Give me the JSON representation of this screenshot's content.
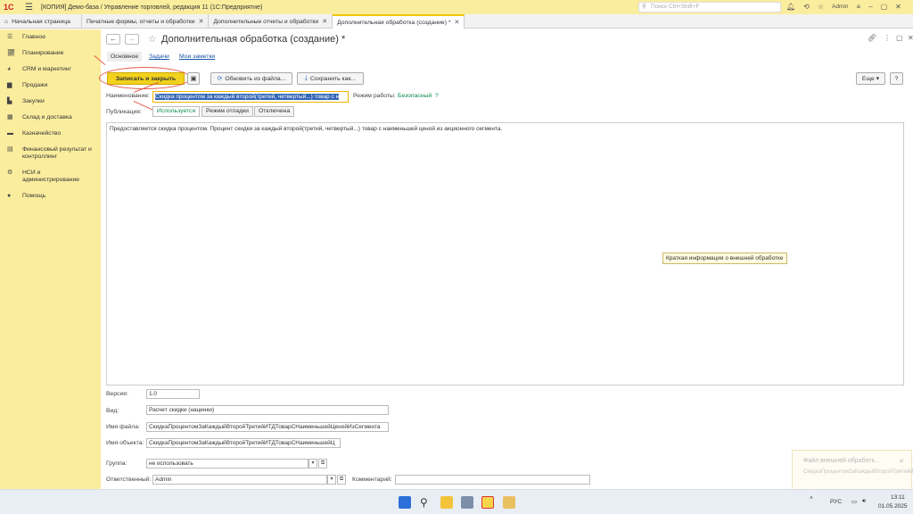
{
  "window": {
    "title": "[КОПИЯ] Демо-база / Управление торговлей, редакция 11  (1С:Предприятие)",
    "search_placeholder": "Поиск Ctrl+Shift+F",
    "user": "Admin"
  },
  "tabs": [
    {
      "label": "Начальная страница"
    },
    {
      "label": "Печатные формы, отчеты и обработки"
    },
    {
      "label": "Дополнительные отчеты и обработки"
    },
    {
      "label": "Дополнительная обработка (создание) *"
    }
  ],
  "sidebar": {
    "items": [
      {
        "label": "Главное",
        "icon": "menu-icon"
      },
      {
        "label": "Планирование",
        "icon": "chart-icon"
      },
      {
        "label": "CRM и маркетинг",
        "icon": "crm-icon"
      },
      {
        "label": "Продажи",
        "icon": "bag-icon"
      },
      {
        "label": "Закупки",
        "icon": "cart-icon"
      },
      {
        "label": "Склад и доставка",
        "icon": "warehouse-icon"
      },
      {
        "label": "Казначейство",
        "icon": "money-icon"
      },
      {
        "label": "Финансовый результат и контроллинг",
        "icon": "finance-icon"
      },
      {
        "label": "НСИ и администрирование",
        "icon": "gear-icon"
      },
      {
        "label": "Помощь",
        "icon": "help-icon"
      }
    ]
  },
  "form": {
    "title": "Дополнительная обработка (создание) *",
    "subtabs": {
      "main": "Основное",
      "tasks": "Задачи",
      "notes": "Мои заметки"
    },
    "buttons": {
      "save_close": "Записать и закрыть",
      "update_from_file": "Обновить из файла...",
      "save_as": "Сохранить как...",
      "more": "Еще",
      "help": "?"
    },
    "name_label": "Наименование:",
    "name_value": "Скидка процентом за каждый второй(третий, четвертый...) товар с н",
    "mode_label": "Режим работы:",
    "mode_value": "Безопасный",
    "mode_help": "?",
    "publication_label": "Публикация:",
    "publication_options": [
      "Используется",
      "Режим отладки",
      "Отключена"
    ],
    "description": "Предоставляется скидка процентом. Процент скидки за каждый второй(третий, четвертый...) товар с наименьшей ценой из акционного сегмента.",
    "tooltip": "Краткая информация о внешней обработке",
    "version_label": "Версия:",
    "version_value": "1.0",
    "kind_label": "Вид:",
    "kind_value": "Расчет скидки (наценки)",
    "filename_label": "Имя файла:",
    "filename_value": "СкидкаПроцентомЗаКаждыйВторойТретийИТДТоварСНаименьшейЦенойИзСегмента",
    "objname_label": "Имя объекта:",
    "objname_value": "СкидкаПроцентомЗаКаждыйВторойТретийИТДТоварСНаименьшейЦ",
    "group_label": "Группа:",
    "group_value": "не использовать",
    "responsible_label": "Ответственный:",
    "responsible_value": "Admin",
    "comment_label": "Комментарий:",
    "comment_value": ""
  },
  "notification": {
    "title": "Файл внешней обработк...",
    "body": "СкидкаПроцентомЗаКаждыйВторойТретийИТДТоварСНан..."
  },
  "taskbar": {
    "lang": "РУС",
    "time": "13:11",
    "date": "01.05.2025"
  },
  "colors": {
    "accent": "#f2d21c",
    "sidebar": "#fbed9e",
    "link": "#1a55a8",
    "highlight": "#e45a4a"
  }
}
